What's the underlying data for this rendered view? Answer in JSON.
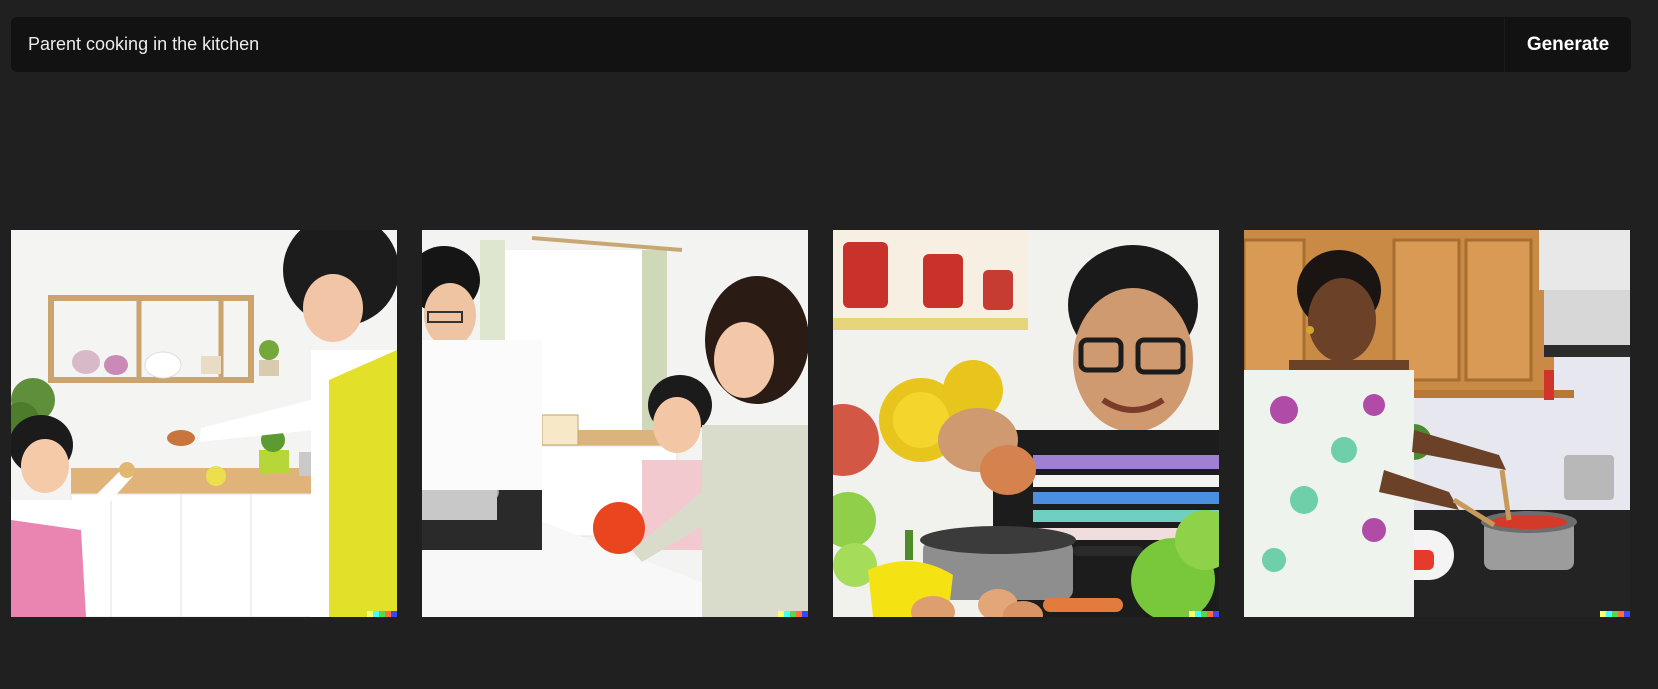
{
  "prompt": {
    "text": "Parent cooking in the kitchen",
    "generate_label": "Generate"
  },
  "results": [
    {
      "id": 1
    },
    {
      "id": 2
    },
    {
      "id": 3
    },
    {
      "id": 4
    }
  ],
  "signature_colors": [
    "#ffff66",
    "#42ffff",
    "#51da4c",
    "#ff6e3c",
    "#3c46ff"
  ]
}
